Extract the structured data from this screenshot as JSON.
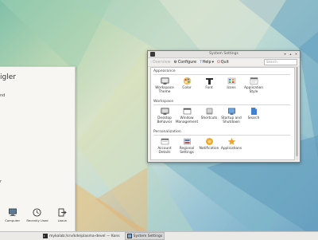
{
  "launcher": {
    "user_name": "igler",
    "items": [
      "nd",
      "",
      "",
      "",
      "",
      "",
      "",
      "",
      "",
      "r",
      ""
    ],
    "buttons": [
      {
        "label": "Computer",
        "icon": "computer-icon"
      },
      {
        "label": "Recently Used",
        "icon": "clock-icon"
      },
      {
        "label": "Leave",
        "icon": "leave-icon"
      }
    ]
  },
  "window": {
    "title": "System Settings",
    "toolbar": {
      "overview": "Overview",
      "configure": "Configure",
      "help": "Help",
      "quit": "Quit",
      "search_placeholder": "Search"
    },
    "sections": [
      {
        "title": "Appearance",
        "items": [
          {
            "label": "Workspace Theme",
            "icon": "workspace-theme-icon"
          },
          {
            "label": "Color",
            "icon": "color-icon"
          },
          {
            "label": "Font",
            "icon": "font-icon"
          },
          {
            "label": "Icons",
            "icon": "icons-icon"
          },
          {
            "label": "Application Style",
            "icon": "application-style-icon"
          }
        ]
      },
      {
        "title": "Workspace",
        "items": [
          {
            "label": "Desktop Behavior",
            "icon": "desktop-behavior-icon"
          },
          {
            "label": "Window Management",
            "icon": "window-management-icon"
          },
          {
            "label": "Shortcuts",
            "icon": "shortcuts-icon"
          },
          {
            "label": "Startup and Shutdown",
            "icon": "startup-shutdown-icon"
          },
          {
            "label": "Search",
            "icon": "search-icon"
          }
        ]
      },
      {
        "title": "Personalization",
        "items": [
          {
            "label": "Account Details",
            "icon": "account-details-icon"
          },
          {
            "label": "Regional Settings",
            "icon": "regional-settings-icon"
          },
          {
            "label": "Notification",
            "icon": "notification-icon"
          },
          {
            "label": "Applications",
            "icon": "applications-icon"
          }
        ]
      }
    ]
  },
  "taskbar": {
    "tasks": [
      {
        "label": "mykolab:/srv/kde/plasma-devel — Kons",
        "icon": "terminal-icon"
      },
      {
        "label": "System Settings",
        "icon": "settings-icon"
      }
    ]
  }
}
